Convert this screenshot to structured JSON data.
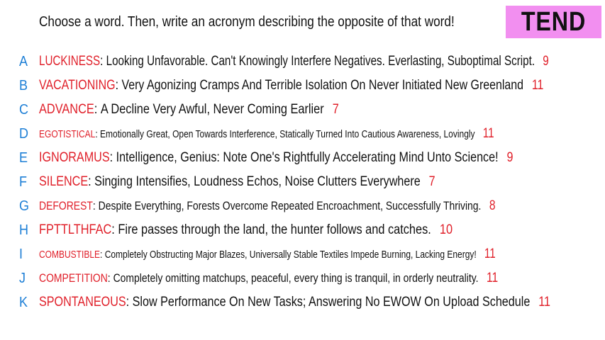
{
  "prompt": "Choose a word. Then, write an acronym describing the opposite of that word!",
  "target_word": "TEND",
  "entries": [
    {
      "letter": "A",
      "word": "LUCKINESS",
      "acronym": "Looking Unfavorable. Can't Knowingly Interfere Negatives. Everlasting, Suboptimal Script.",
      "score": "9"
    },
    {
      "letter": "B",
      "word": "VACATIONING",
      "acronym": "Very Agonizing Cramps And Terrible Isolation On Never Initiated New Greenland",
      "score": "11"
    },
    {
      "letter": "C",
      "word": "ADVANCE",
      "acronym": "A Decline Very Awful, Never Coming Earlier",
      "score": "7"
    },
    {
      "letter": "D",
      "word": "EGOTISTICAL",
      "acronym": "Emotionally Great, Open Towards Interference, Statically Turned Into Cautious Awareness, Lovingly",
      "score": "11"
    },
    {
      "letter": "E",
      "word": "IGNORAMUS",
      "acronym": "Intelligence, Genius: Note One's Rightfully Accelerating Mind Unto Science!",
      "score": "9"
    },
    {
      "letter": "F",
      "word": "SILENCE",
      "acronym": "Singing Intensifies, Loudness Echos, Noise Clutters Everywhere",
      "score": "7"
    },
    {
      "letter": "G",
      "word": "DEFOREST",
      "acronym": "Despite Everything, Forests Overcome Repeated Encroachment, Successfully Thriving.",
      "score": "8"
    },
    {
      "letter": "H",
      "word": "FPTTLTHFAC",
      "acronym": "Fire passes through the land, the hunter follows and catches.",
      "score": "10"
    },
    {
      "letter": "I",
      "word": "COMBUSTIBLE",
      "acronym": "Completely Obstructing Major Blazes, Universally Stable Textiles Impede Burning, Lacking Energy!",
      "score": "11"
    },
    {
      "letter": "J",
      "word": "COMPETITION",
      "acronym": "Completely omitting matchups, peaceful, every thing is tranquil, in orderly neutrality.",
      "score": "11"
    },
    {
      "letter": "K",
      "word": "SPONTANEOUS",
      "acronym": "Slow Performance On New Tasks; Answering No EWOW On Upload Schedule",
      "score": "11"
    }
  ]
}
